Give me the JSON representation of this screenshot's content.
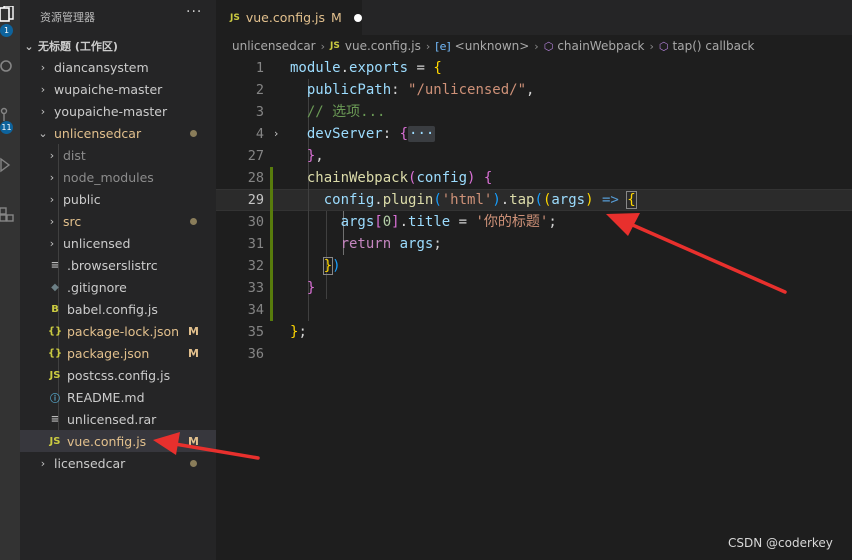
{
  "activity_bar": {
    "items": [
      {
        "icon": "files-icon"
      },
      {
        "icon": "search-icon"
      },
      {
        "icon": "source-control-icon",
        "badge": "11"
      },
      {
        "icon": "run-debug-icon"
      },
      {
        "icon": "extensions-icon"
      }
    ],
    "explorer_badge": "1"
  },
  "sidebar": {
    "title": "资源管理器",
    "more": "···",
    "workspace": "无标题 (工作区)",
    "tree": [
      {
        "label": "diancansystem",
        "kind": "folder",
        "depth": 0
      },
      {
        "label": "wupaiche-master",
        "kind": "folder",
        "depth": 0
      },
      {
        "label": "youpaiche-master",
        "kind": "folder",
        "depth": 0
      },
      {
        "label": "unlicensedcar",
        "kind": "folder-open",
        "depth": 0,
        "status": "dot",
        "modified": true
      },
      {
        "label": "dist",
        "kind": "folder",
        "depth": 1,
        "dim": true
      },
      {
        "label": "node_modules",
        "kind": "folder",
        "depth": 1,
        "dim": true
      },
      {
        "label": "public",
        "kind": "folder",
        "depth": 1
      },
      {
        "label": "src",
        "kind": "folder",
        "depth": 1,
        "status": "dot",
        "modified": true
      },
      {
        "label": "unlicensed",
        "kind": "folder",
        "depth": 1
      },
      {
        "label": ".browserslistrc",
        "kind": "file",
        "icon": "≡",
        "icon_color": "#bbbbbb",
        "depth": 1
      },
      {
        "label": ".gitignore",
        "kind": "file",
        "icon": "◆",
        "icon_color": "#6d8086",
        "depth": 1
      },
      {
        "label": "babel.config.js",
        "kind": "file",
        "icon": "B",
        "icon_color": "#cbcb41",
        "depth": 1
      },
      {
        "label": "package-lock.json",
        "kind": "file",
        "icon": "{}",
        "icon_color": "#cbcb41",
        "depth": 1,
        "status": "M",
        "modified": true
      },
      {
        "label": "package.json",
        "kind": "file",
        "icon": "{}",
        "icon_color": "#cbcb41",
        "depth": 1,
        "status": "M",
        "modified": true
      },
      {
        "label": "postcss.config.js",
        "kind": "file",
        "icon": "JS",
        "icon_color": "#cbcb41",
        "depth": 1
      },
      {
        "label": "README.md",
        "kind": "file",
        "icon": "ⓘ",
        "icon_color": "#519aba",
        "depth": 1
      },
      {
        "label": "unlicensed.rar",
        "kind": "file",
        "icon": "≡",
        "icon_color": "#bbbbbb",
        "depth": 1
      },
      {
        "label": "vue.config.js",
        "kind": "file",
        "icon": "JS",
        "icon_color": "#cbcb41",
        "depth": 1,
        "status": "M",
        "modified": true,
        "selected": true
      },
      {
        "label": "licensedcar",
        "kind": "folder",
        "depth": 0,
        "status": "dot"
      }
    ]
  },
  "tab": {
    "icon": "JS",
    "name": "vue.config.js",
    "status": "M"
  },
  "breadcrumb": [
    {
      "label": "unlicensedcar",
      "icon": ""
    },
    {
      "label": "vue.config.js",
      "icon": "JS"
    },
    {
      "label": "<unknown>",
      "icon": "[e]"
    },
    {
      "label": "chainWebpack",
      "icon": "cube"
    },
    {
      "label": "tap() callback",
      "icon": "cube"
    }
  ],
  "editor": {
    "line_numbers": [
      "1",
      "2",
      "3",
      "4",
      "27",
      "28",
      "29",
      "30",
      "31",
      "32",
      "33",
      "34",
      "35",
      "36"
    ],
    "active_line": "29",
    "lines": [
      [
        {
          "t": "module",
          "c": "var"
        },
        {
          "t": ".",
          "c": ""
        },
        {
          "t": "exports",
          "c": "var"
        },
        {
          "t": " = ",
          "c": ""
        },
        {
          "t": "{",
          "c": "br1"
        }
      ],
      [
        {
          "t": "  publicPath",
          "c": "prop"
        },
        {
          "t": ": ",
          "c": ""
        },
        {
          "t": "\"/unlicensed/\"",
          "c": "str"
        },
        {
          "t": ",",
          "c": ""
        }
      ],
      [
        {
          "t": "  // 选项...",
          "c": "cmt"
        }
      ],
      [
        {
          "t": "  devServer",
          "c": "prop"
        },
        {
          "t": ": ",
          "c": ""
        },
        {
          "t": "{",
          "c": "br2"
        },
        {
          "t": "···",
          "c": "fold-dots"
        }
      ],
      [
        {
          "t": "  ",
          "c": ""
        },
        {
          "t": "}",
          "c": "br2"
        },
        {
          "t": ",",
          "c": ""
        }
      ],
      [
        {
          "t": "  ",
          "c": ""
        },
        {
          "t": "chainWebpack",
          "c": "fn"
        },
        {
          "t": "(",
          "c": "br2"
        },
        {
          "t": "config",
          "c": "var"
        },
        {
          "t": ")",
          "c": "br2"
        },
        {
          "t": " ",
          "c": ""
        },
        {
          "t": "{",
          "c": "br2"
        }
      ],
      [
        {
          "t": "    config",
          "c": "var"
        },
        {
          "t": ".",
          "c": ""
        },
        {
          "t": "plugin",
          "c": "fn"
        },
        {
          "t": "(",
          "c": "br3"
        },
        {
          "t": "'html'",
          "c": "str"
        },
        {
          "t": ")",
          "c": "br3"
        },
        {
          "t": ".",
          "c": ""
        },
        {
          "t": "tap",
          "c": "fn"
        },
        {
          "t": "(",
          "c": "br3"
        },
        {
          "t": "(",
          "c": "br1"
        },
        {
          "t": "args",
          "c": "var"
        },
        {
          "t": ")",
          "c": "br1"
        },
        {
          "t": " ",
          "c": ""
        },
        {
          "t": "=>",
          "c": "kw-b"
        },
        {
          "t": " ",
          "c": ""
        },
        {
          "t": "{",
          "c": "br1 bmatch"
        }
      ],
      [
        {
          "t": "      args",
          "c": "var"
        },
        {
          "t": "[",
          "c": "br2"
        },
        {
          "t": "0",
          "c": "num"
        },
        {
          "t": "]",
          "c": "br2"
        },
        {
          "t": ".",
          "c": ""
        },
        {
          "t": "title",
          "c": "prop"
        },
        {
          "t": " = ",
          "c": ""
        },
        {
          "t": "'你的标题'",
          "c": "str"
        },
        {
          "t": ";",
          "c": ""
        }
      ],
      [
        {
          "t": "      ",
          "c": ""
        },
        {
          "t": "return",
          "c": "kw-p"
        },
        {
          "t": " ",
          "c": ""
        },
        {
          "t": "args",
          "c": "var"
        },
        {
          "t": ";",
          "c": ""
        }
      ],
      [
        {
          "t": "    ",
          "c": ""
        },
        {
          "t": "}",
          "c": "br1 bmatch"
        },
        {
          "t": ")",
          "c": "br3"
        }
      ],
      [
        {
          "t": "  ",
          "c": ""
        },
        {
          "t": "}",
          "c": "br2"
        }
      ],
      [
        {
          "t": "",
          "c": ""
        }
      ],
      [
        {
          "t": "}",
          "c": "br1"
        },
        {
          "t": ";",
          "c": ""
        }
      ],
      [
        {
          "t": "",
          "c": ""
        }
      ]
    ]
  },
  "watermark": "CSDN @coderkey",
  "colors": {
    "accent": "#0e639c",
    "modified": "#e2c08d",
    "arrow": "#e8302d",
    "added_bar": "#587c0c"
  }
}
